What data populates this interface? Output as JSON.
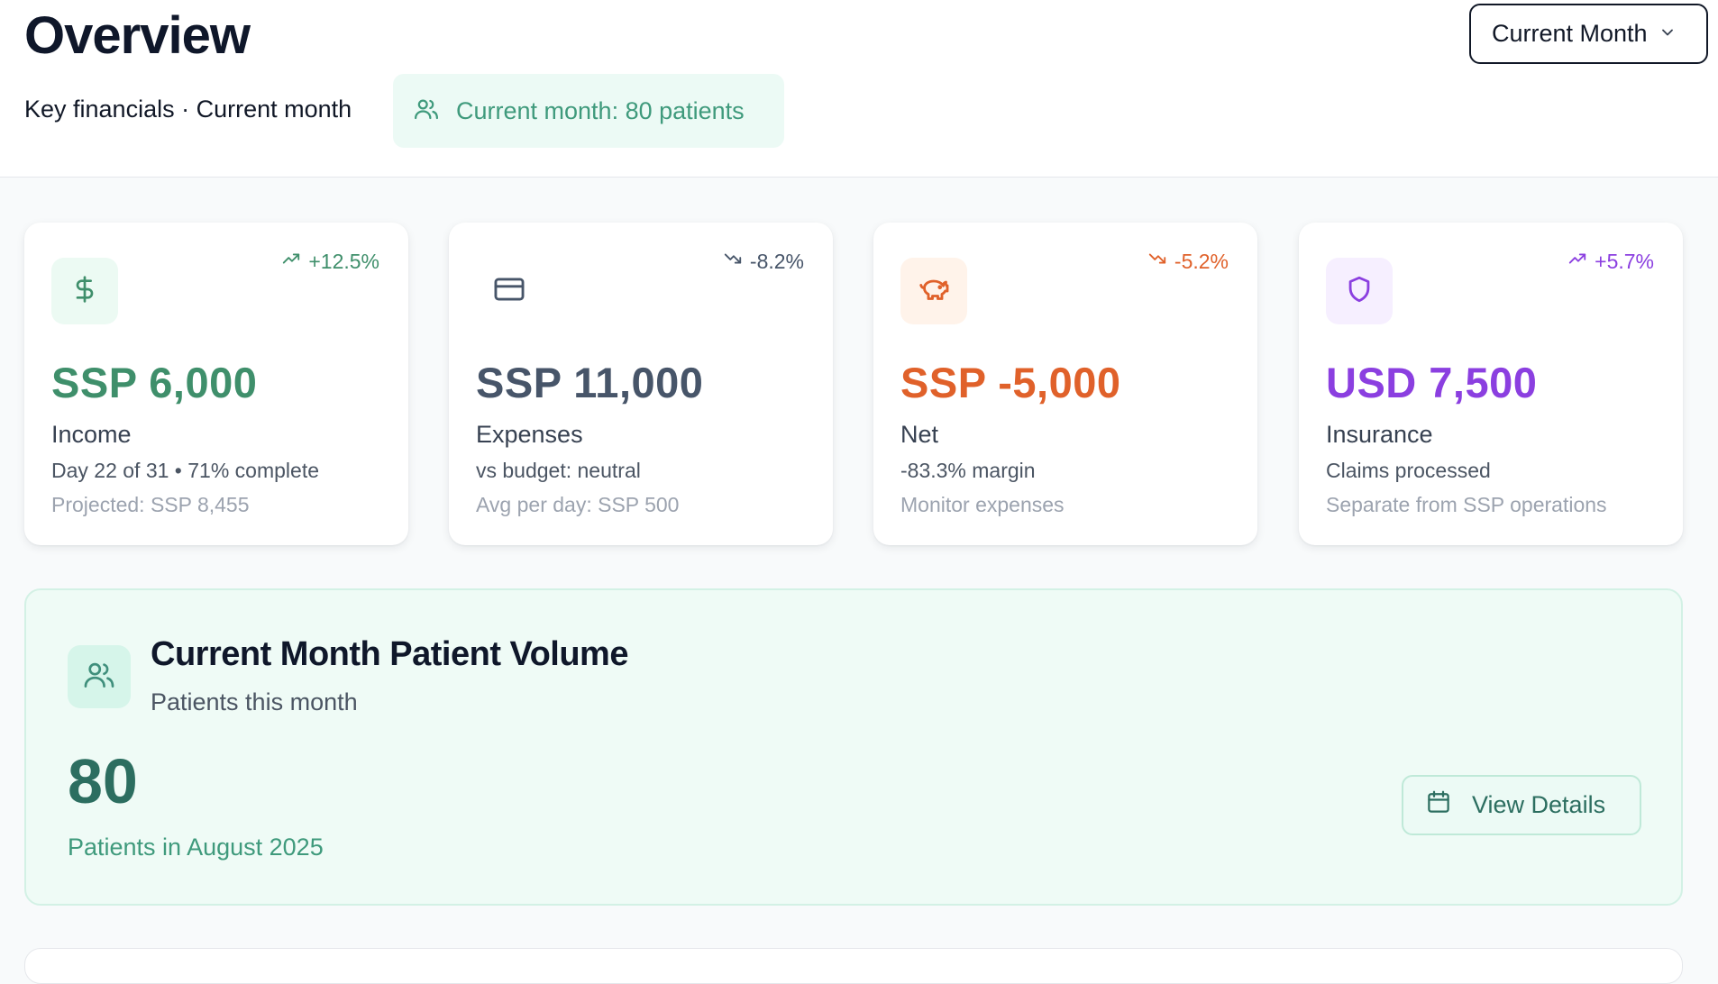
{
  "header": {
    "title": "Overview",
    "subtitle": "Key financials · Current month",
    "patients_pill": "Current month: 80 patients",
    "period_select": "Current Month"
  },
  "cards": [
    {
      "amount": "SSP 6,000",
      "label": "Income",
      "trend": "+12.5%",
      "trend_direction": "up",
      "line1": "Day 22 of 31 • 71% complete",
      "line2": "Projected: SSP 8,455",
      "icon": "dollar-icon",
      "accent": "#3f8f6b",
      "tile_bg": "#ecfaf3"
    },
    {
      "amount": "SSP 11,000",
      "label": "Expenses",
      "trend": "-8.2%",
      "trend_direction": "down",
      "line1": "vs budget: neutral",
      "line2": "Avg per day: SSP 500",
      "icon": "credit-card-icon",
      "accent": "#475569",
      "tile_bg": "#ffffff"
    },
    {
      "amount": "SSP -5,000",
      "label": "Net",
      "trend": "-5.2%",
      "trend_direction": "down",
      "line1": "-83.3% margin",
      "line2": "Monitor expenses",
      "icon": "piggy-bank-icon",
      "accent": "#e0612a",
      "tile_bg": "#fff3ea"
    },
    {
      "amount": "USD 7,500",
      "label": "Insurance",
      "trend": "+5.7%",
      "trend_direction": "up",
      "line1": "Claims processed",
      "line2": "Separate from SSP operations",
      "icon": "shield-icon",
      "accent": "#8b3fe0",
      "tile_bg": "#f6efff"
    }
  ],
  "volume": {
    "title": "Current Month Patient Volume",
    "subtitle": "Patients this month",
    "count": "80",
    "period": "Patients in August 2025",
    "button": "View Details"
  }
}
